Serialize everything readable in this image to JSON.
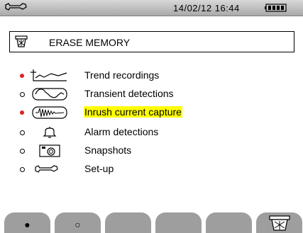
{
  "status_bar": {
    "tool_icon": "wrench-and-key-icon",
    "datetime": "14/02/12 16:44",
    "battery_icon": "battery-icon"
  },
  "header": {
    "icon": "trash-bin-icon",
    "title": "ERASE MEMORY"
  },
  "items": [
    {
      "label": "Trend recordings",
      "icon": "trend-graph-icon",
      "selected": true,
      "highlighted": false
    },
    {
      "label": "Transient detections",
      "icon": "transient-wave-icon",
      "selected": false,
      "highlighted": false
    },
    {
      "label": "Inrush current capture",
      "icon": "inrush-wave-icon",
      "selected": true,
      "highlighted": true
    },
    {
      "label": "Alarm detections",
      "icon": "bell-icon",
      "selected": false,
      "highlighted": false
    },
    {
      "label": "Snapshots",
      "icon": "camera-icon",
      "selected": false,
      "highlighted": false
    },
    {
      "label": "Set-up",
      "icon": "wrench-and-key-icon",
      "selected": false,
      "highlighted": false
    }
  ],
  "softkeys": [
    {
      "symbol": "●",
      "name": "select-all"
    },
    {
      "symbol": "○",
      "name": "deselect-all"
    },
    {
      "symbol": "",
      "name": "empty-3"
    },
    {
      "symbol": "",
      "name": "empty-4"
    },
    {
      "symbol": "",
      "name": "empty-5"
    },
    {
      "symbol": "",
      "name": "trash-bin-icon"
    }
  ],
  "colors": {
    "selected_dot": "#e02020",
    "highlight": "#ffff00",
    "softkey": "#9e9e9e"
  }
}
